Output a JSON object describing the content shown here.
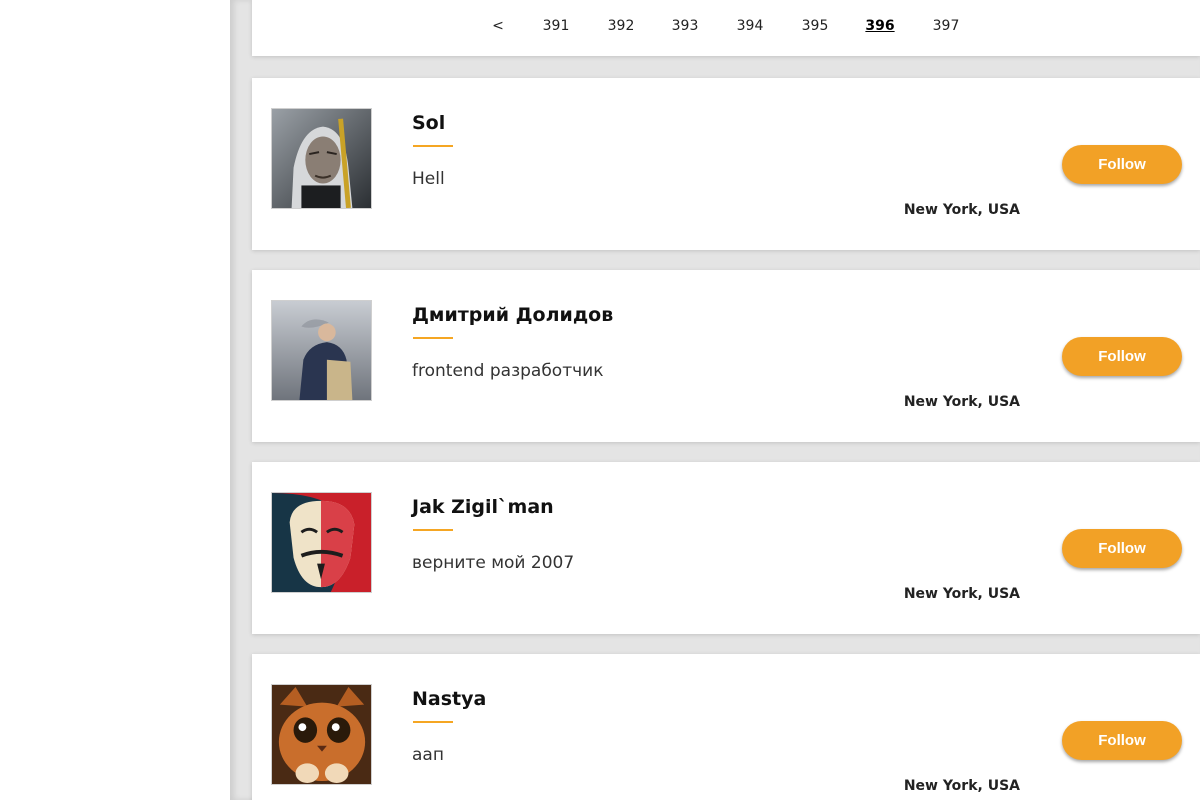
{
  "pagination": {
    "prev_label": "<",
    "pages": [
      "391",
      "392",
      "393",
      "394",
      "395",
      "396",
      "397"
    ],
    "current_page": "396"
  },
  "users": [
    {
      "name": "Sol",
      "status": "Hell",
      "location": "New York, USA",
      "follow_label": "Follow",
      "avatar_icon": "witcher-portrait"
    },
    {
      "name": "Дмитрий Долидов",
      "status": "frontend разработчик",
      "location": "New York, USA",
      "follow_label": "Follow",
      "avatar_icon": "man-photo-outdoor"
    },
    {
      "name": "Jak Zigil`man",
      "status": "верните мой 2007",
      "location": "New York, USA",
      "follow_label": "Follow",
      "avatar_icon": "guy-fawkes-mask"
    },
    {
      "name": "Nastya",
      "status": "аап",
      "location": "New York, USA",
      "follow_label": "Follow",
      "avatar_icon": "puss-in-boots-cat"
    }
  ],
  "colors": {
    "accent": "#f2a126",
    "underline": "#f5a623",
    "background": "#e4e4e4",
    "card": "#ffffff"
  }
}
